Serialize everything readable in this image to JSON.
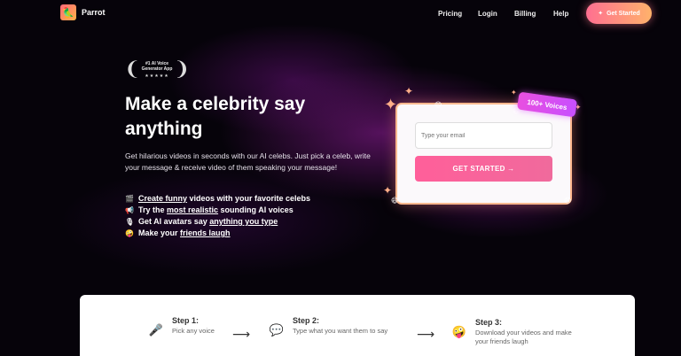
{
  "nav": {
    "brand": "Parrot",
    "links": [
      "Pricing",
      "Login",
      "Billing",
      "Help"
    ],
    "cta": "Get Started"
  },
  "award": {
    "title": "#1 AI Voice Generator App",
    "stars": "★★★★★"
  },
  "hero": {
    "headline": "Make a celebrity say anything",
    "subtext": "Get hilarious videos in seconds with our AI celebs. Just pick a celeb, write your message & receive video of them speaking your message!",
    "features": [
      {
        "icon": "🎬",
        "parts": [
          {
            "t": "Create funny",
            "u": true
          },
          {
            "t": " videos with your favorite celebs",
            "u": false
          }
        ]
      },
      {
        "icon": "📢",
        "parts": [
          {
            "t": "Try the ",
            "u": false
          },
          {
            "t": "most realistic",
            "u": true
          },
          {
            "t": " sounding AI voices",
            "u": false
          }
        ]
      },
      {
        "icon": "🎙",
        "parts": [
          {
            "t": "Get AI avatars say ",
            "u": false
          },
          {
            "t": "anything you type",
            "u": true
          }
        ]
      },
      {
        "icon": "🤪",
        "parts": [
          {
            "t": "Make your ",
            "u": false
          },
          {
            "t": "friends laugh",
            "u": true
          }
        ]
      }
    ]
  },
  "form": {
    "email_placeholder": "Type your email",
    "submit_label": "GET STARTED →",
    "voices_badge": "100+ Voices"
  },
  "steps": [
    {
      "title": "Step 1:",
      "desc": "Pick any voice",
      "icon": "🎤"
    },
    {
      "title": "Step 2:",
      "desc": "Type what you want them to say",
      "icon": "💬"
    },
    {
      "title": "Step 3:",
      "desc": "Download your videos and make your friends laugh",
      "icon": "🤪"
    }
  ]
}
